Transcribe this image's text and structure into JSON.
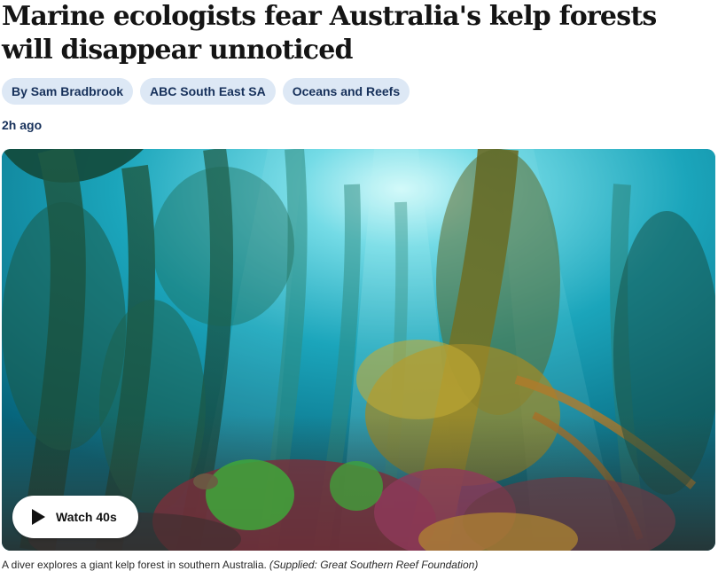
{
  "headline": "Marine ecologists fear Australia's kelp forests will disappear unnoticed",
  "tags": [
    {
      "label": "By Sam Bradbrook"
    },
    {
      "label": "ABC South East SA"
    },
    {
      "label": "Oceans and Reefs"
    }
  ],
  "timestamp": "2h ago",
  "media": {
    "play_icon": "play-icon",
    "watch_label": "Watch 40s"
  },
  "caption": {
    "text": "A diver explores a giant kelp forest in southern Australia.",
    "credit": "(Supplied: Great Southern Reef Foundation)"
  },
  "colors": {
    "tag_background": "#dde8f5",
    "tag_text": "#16305a",
    "water": "#0f8aa0"
  }
}
